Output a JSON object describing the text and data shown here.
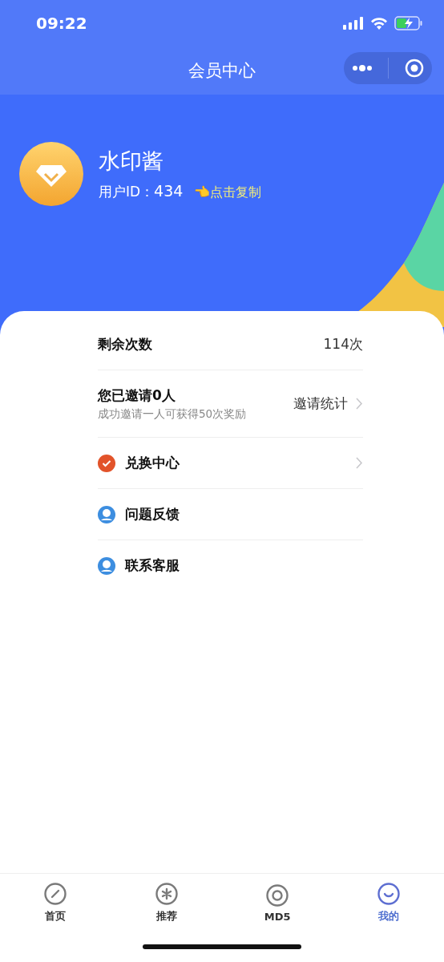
{
  "status_bar": {
    "time": "09:22"
  },
  "nav_bar": {
    "title": "会员中心"
  },
  "profile": {
    "name": "水印酱",
    "id_label": "用户ID：",
    "id_value": "434",
    "copy_hint": "👈点击复制"
  },
  "menu": [
    {
      "kind": "stat",
      "label": "剩余次数",
      "value": "114次"
    },
    {
      "kind": "invite",
      "title": "您已邀请0人",
      "subtitle": "成功邀请一人可获得50次奖励",
      "action": "邀请统计",
      "has_arrow": true
    },
    {
      "kind": "link",
      "label": "兑换中心",
      "has_arrow": true
    },
    {
      "kind": "link",
      "label": "问题反馈",
      "has_arrow": false
    },
    {
      "kind": "link",
      "label": "联系客服",
      "has_arrow": false
    }
  ],
  "tabs": [
    {
      "label": "首页",
      "selected": false
    },
    {
      "label": "推荐",
      "selected": false
    },
    {
      "label": "MD5",
      "selected": false
    },
    {
      "label": "我的",
      "selected": true
    }
  ]
}
